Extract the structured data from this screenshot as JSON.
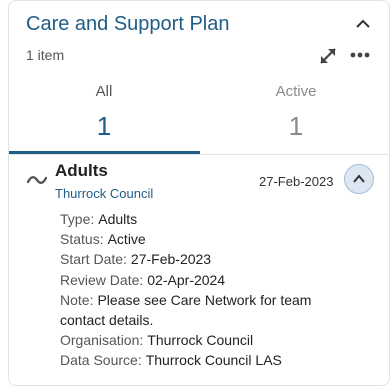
{
  "card": {
    "title": "Care and Support Plan",
    "item_count": "1 item"
  },
  "tabs": [
    {
      "label": "All",
      "count": "1"
    },
    {
      "label": "Active",
      "count": "1"
    }
  ],
  "record": {
    "title": "Adults",
    "subtitle": "Thurrock Council",
    "date": "27-Feb-2023",
    "details": {
      "type_label": "Type:",
      "type_value": "Adults",
      "status_label": "Status:",
      "status_value": "Active",
      "start_label": "Start Date:",
      "start_value": "27-Feb-2023",
      "review_label": "Review Date:",
      "review_value": "02-Apr-2024",
      "note_label": "Note:",
      "note_value": "Please see Care Network for team contact details.",
      "org_label": "Organisation:",
      "org_value": "Thurrock Council",
      "source_label": "Data Source:",
      "source_value": "Thurrock Council LAS"
    }
  },
  "icons": {
    "collapse": "chevron-up-icon",
    "expand": "expand-arrows-icon",
    "more": "more-horizontal-icon",
    "record": "tilde-wave-icon",
    "record_toggle": "chevron-up-icon"
  },
  "colors": {
    "accent": "#1f5d86",
    "toggle_bg": "#dce7f2"
  }
}
